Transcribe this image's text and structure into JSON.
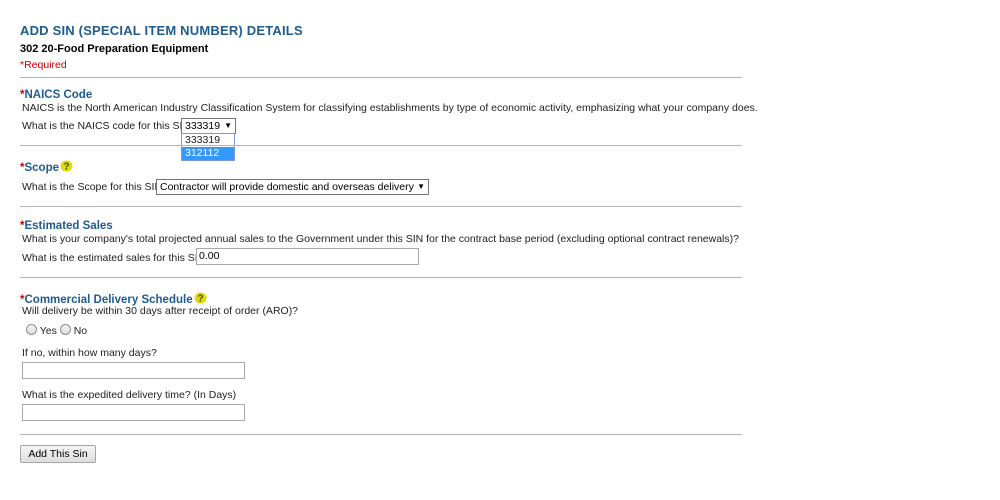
{
  "header": {
    "title": "ADD SIN (SPECIAL ITEM NUMBER) DETAILS",
    "subtitle": "302 20-Food Preparation Equipment",
    "required_note": "*Required"
  },
  "naics": {
    "star": "*",
    "heading": "NAICS Code",
    "description": "NAICS is the North American Industry Classification System for classifying establishments by type of economic activity, emphasizing what your company does.",
    "question": "What is the NAICS code for this SIN?",
    "selected": "333319",
    "options": [
      "333319",
      "312112"
    ],
    "highlighted": "312112"
  },
  "scope": {
    "star": "*",
    "heading": "Scope",
    "question": "What is the Scope for this SIN?",
    "selected": "Contractor will provide domestic and overseas delivery"
  },
  "sales": {
    "star": "*",
    "heading": "Estimated Sales",
    "description": "What is your company's total projected annual sales to the Government under this SIN for the contract base period (excluding optional contract renewals)?",
    "question": "What is the estimated sales for this SIN?",
    "value": "0.00"
  },
  "delivery": {
    "star": "*",
    "heading": "Commercial Delivery Schedule",
    "question": "Will delivery be within 30 days after receipt of order (ARO)?",
    "yes_label": "Yes",
    "no_label": "No",
    "days_label": "If no, within how many days?",
    "days_value": "",
    "expedited_label": "What is the expedited delivery time? (In Days)",
    "expedited_value": ""
  },
  "actions": {
    "add_label": "Add This Sin"
  },
  "colors": {
    "heading": "#1f5b8e",
    "required": "#cc0000",
    "highlight": "#3399ff"
  },
  "icons": {
    "help": "help-question-icon"
  }
}
